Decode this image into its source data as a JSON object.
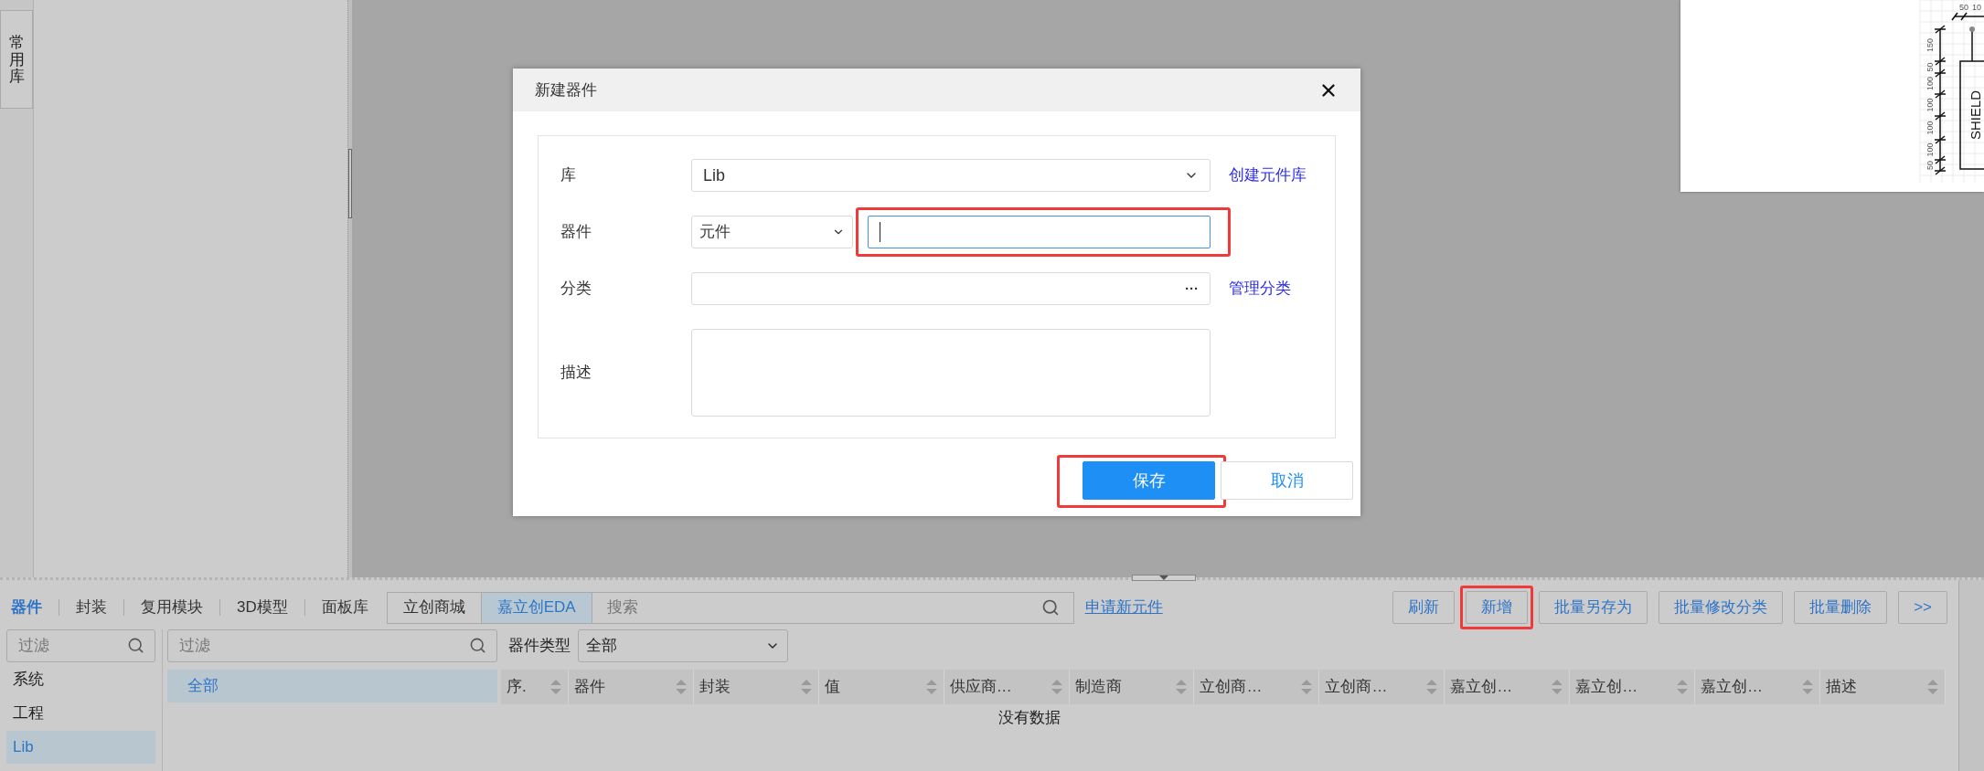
{
  "left_sidebar": {
    "tab": "常用库"
  },
  "schematic": {
    "part_label": "SHIELD",
    "top_labels": [
      "50",
      "10"
    ],
    "dimension_labels": [
      "150",
      "50",
      "100",
      "100",
      "100",
      "100",
      "50"
    ]
  },
  "dialog": {
    "title": "新建器件",
    "fields": [
      {
        "kind": "select",
        "label": "库",
        "value": "Lib",
        "link": "创建元件库",
        "focused": false,
        "highlighted": false
      },
      {
        "kind": "select_input",
        "label": "器件",
        "select_value": "元件",
        "focused": true,
        "highlighted": true
      },
      {
        "kind": "picker",
        "label": "分类",
        "button": "···",
        "link": "管理分类",
        "focused": false,
        "highlighted": false
      },
      {
        "kind": "textarea",
        "label": "描述",
        "focused": false,
        "highlighted": false
      }
    ],
    "buttons": [
      {
        "label": "保存",
        "kind": "primary",
        "highlighted": true
      },
      {
        "label": "取消",
        "kind": "secondary",
        "highlighted": false
      }
    ]
  },
  "library_panel": {
    "tabs": [
      {
        "label": "器件",
        "selected": true
      },
      {
        "label": "封装",
        "selected": false
      },
      {
        "label": "复用模块",
        "selected": false
      },
      {
        "label": "3D模型",
        "selected": false
      },
      {
        "label": "面板库",
        "selected": false
      }
    ],
    "sources": [
      {
        "label": "立创商城",
        "selected": false
      },
      {
        "label": "嘉立创EDA",
        "selected": true
      }
    ],
    "search": {
      "placeholder": "搜索"
    },
    "apply_link": "申请新元件",
    "actions": [
      {
        "label": "刷新",
        "highlighted": false
      },
      {
        "label": "新增",
        "highlighted": true
      },
      {
        "label": "批量另存为",
        "highlighted": false
      },
      {
        "label": "批量修改分类",
        "highlighted": false
      },
      {
        "label": "批量删除",
        "highlighted": false
      },
      {
        "label": ">>",
        "highlighted": false
      }
    ],
    "group_filter": {
      "placeholder": "过滤"
    },
    "groups": [
      {
        "label": "系统",
        "selected": false
      },
      {
        "label": "工程",
        "selected": false
      },
      {
        "label": "Lib",
        "selected": true
      }
    ],
    "category_filter": {
      "placeholder": "过滤"
    },
    "categories": [
      {
        "label": "全部",
        "selected": true
      }
    ],
    "type_filter": {
      "label": "器件类型",
      "value": "全部"
    },
    "table": {
      "columns": [
        "序.",
        "器件",
        "封装",
        "值",
        "供应商…",
        "制造商",
        "立创商…",
        "立创商…",
        "嘉立创…",
        "嘉立创…",
        "嘉立创…",
        "描述"
      ],
      "empty_text": "没有数据"
    }
  }
}
